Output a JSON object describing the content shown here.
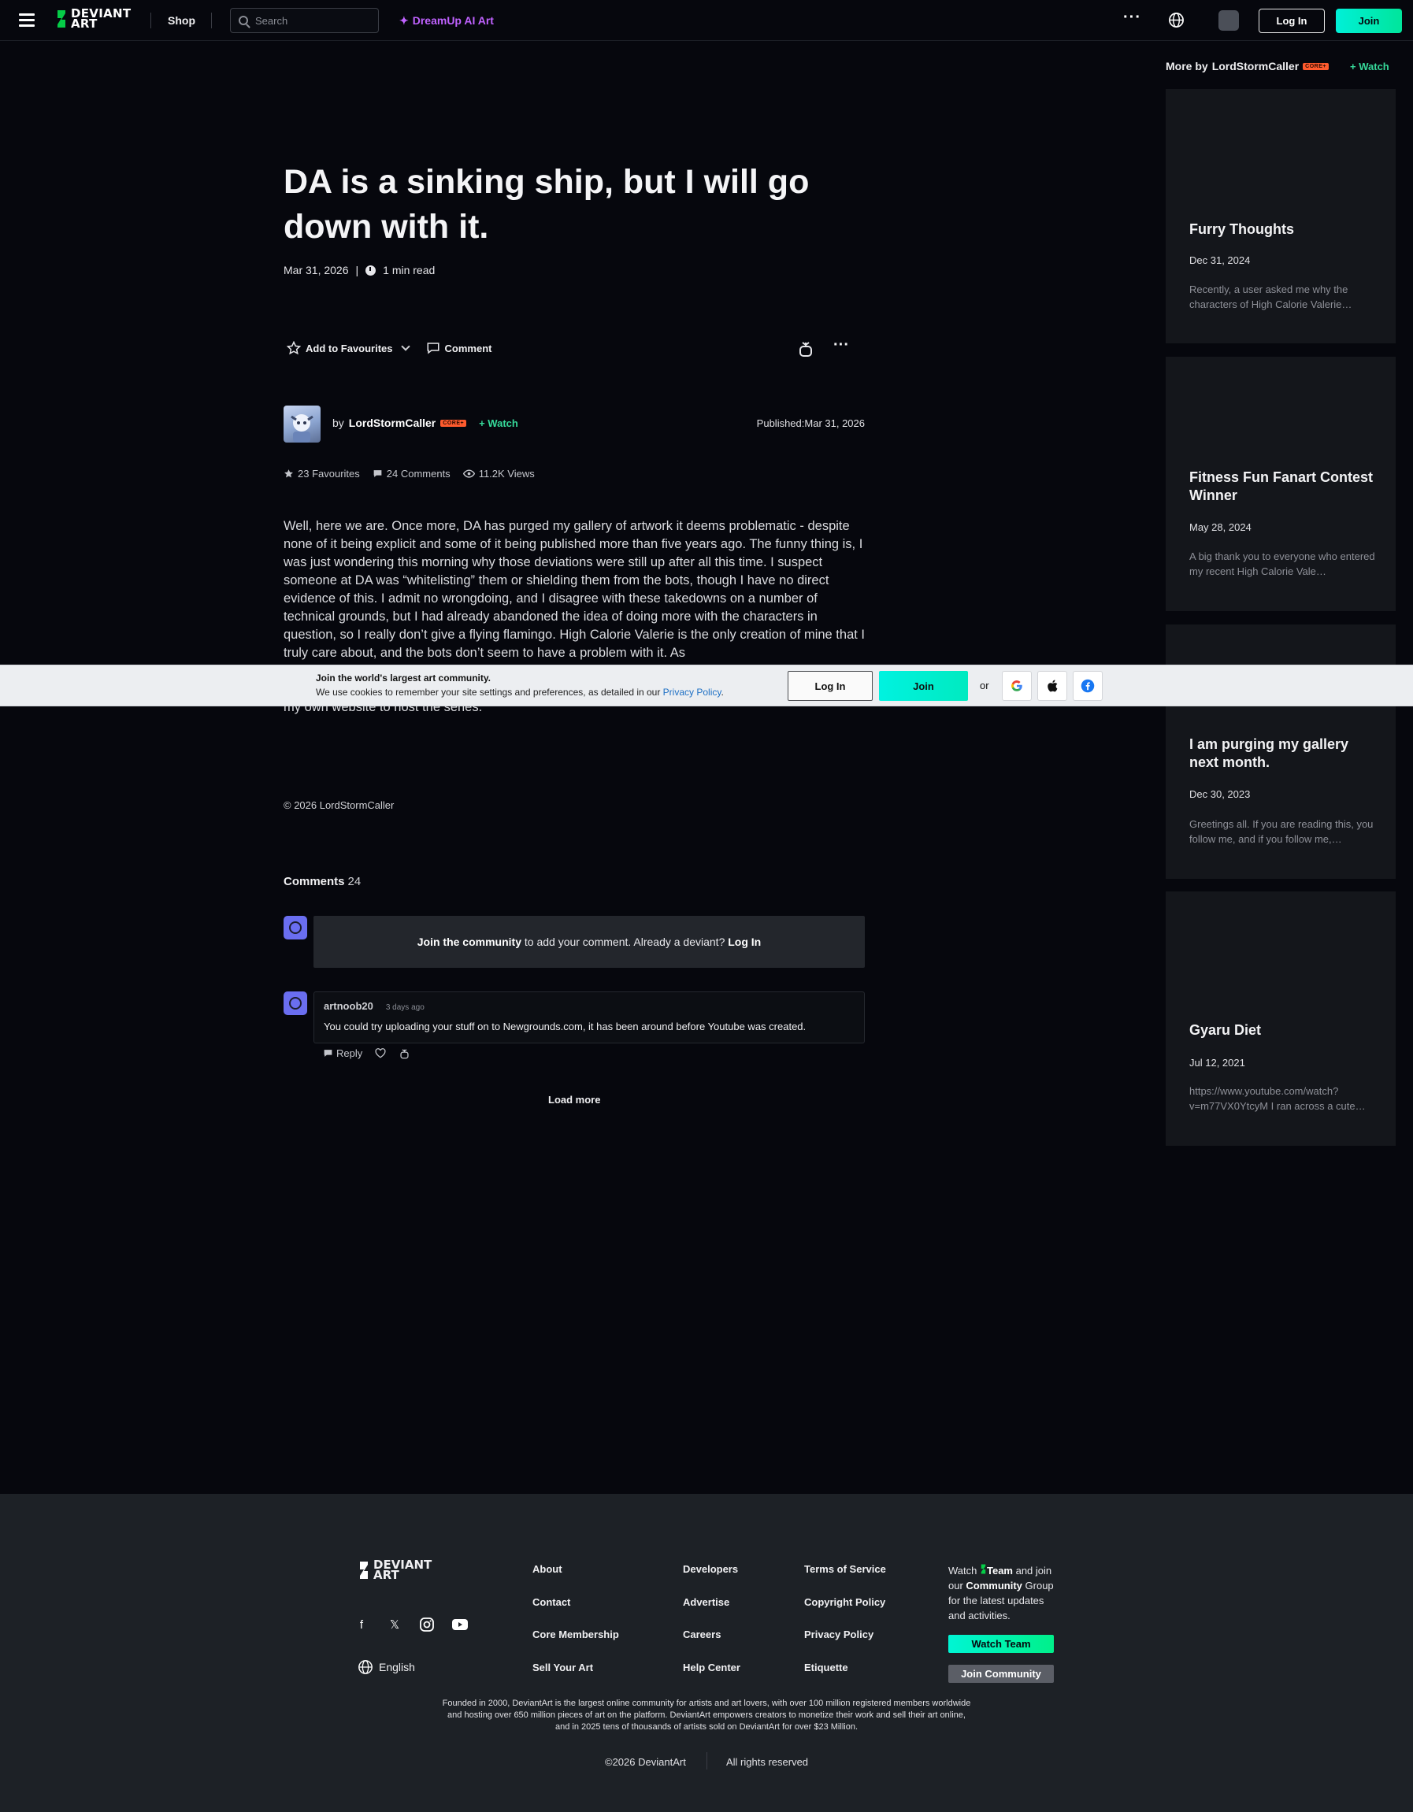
{
  "nav": {
    "logo_text": "DEVIANT ART",
    "shop": "Shop",
    "search_placeholder": "Search",
    "dreamup": "DreamUp AI Art",
    "login": "Log In",
    "join": "Join"
  },
  "article": {
    "title": "DA is a sinking ship, but I will go down with it.",
    "date": "Mar 31, 2026",
    "read_time": "1 min read",
    "add_to_favourites": "Add to Favourites",
    "comment": "Comment",
    "author_by": "by",
    "author_name": "LordStormCaller",
    "core_badge": "CORE+",
    "watch": "Watch",
    "published_label": "Published:",
    "published_date": "Mar 31, 2026",
    "stats": {
      "favourites": "23 Favourites",
      "comments": "24 Comments",
      "views": "11.2K Views"
    },
    "body_visible": "Well, here we are. Once more, DA has purged my gallery of artwork it deems problematic - despite none of it being explicit and some of it being published more than five years ago. The funny thing is, I was just wondering this morning why those deviations were still up after all this time. I suspect someone at DA was “whitelisting” them or shielding them from the bots, though I have no direct evidence of this. I admit no wrongdoing, and I disagree with these takedowns on a number of technical grounds, but I had already abandoned the idea of doing more with the characters in question, so I really don’t give a flying flamingo. High Calorie Valerie is the only creation of mine that I truly care about, and the bots don’t seem to have a problem with it. As",
    "body_after": "Just for the record, though it’s unlikely, if any of my High Calorie Valerie comics get axed, I will create my own website to host the series.",
    "copyright": "© 2026 LordStormCaller"
  },
  "comments": {
    "heading": "Comments",
    "count": "24",
    "join_strong": "Join the community",
    "join_rest": " to add your comment. Already a deviant? ",
    "join_login": "Log In",
    "items": [
      {
        "user": "artnoob20",
        "time": "3 days ago",
        "text": "You could try uploading your stuff on to Newgrounds.com, it has been around before Youtube was created.",
        "reply": "Reply"
      }
    ],
    "load_more": "Load more"
  },
  "sidebar": {
    "heading_prefix": "More by",
    "author": "LordStormCaller",
    "core_badge": "CORE+",
    "watch": "Watch",
    "cards": [
      {
        "title": "Furry Thoughts",
        "date": "Dec 31, 2024",
        "excerpt": "Recently, a user asked me why the characters of High Calorie Valerie…"
      },
      {
        "title": "Fitness Fun Fanart Contest Winner",
        "date": "May 28, 2024",
        "excerpt": "A big thank you to everyone who entered my recent High Calorie Vale…"
      },
      {
        "title": "I am purging my gallery next month.",
        "date": "Dec 30, 2023",
        "excerpt": "Greetings all. If you are reading this, you follow me, and if you follow me,…"
      },
      {
        "title": "Gyaru Diet",
        "date": "Jul 12, 2021",
        "excerpt": "https://www.youtube.com/watch?v=m77VX0YtcyM I ran across a cute…"
      }
    ]
  },
  "cookie": {
    "title": "Join the world's largest art community.",
    "text": "We use cookies to remember your site settings and preferences, as detailed in our ",
    "link": "Privacy Policy",
    "period": ".",
    "login": "Log In",
    "join": "Join",
    "or": "or"
  },
  "footer": {
    "logo_text": "DEVIANT ART",
    "language": "English",
    "col1": [
      "About",
      "Contact",
      "Core Membership",
      "Sell Your Art"
    ],
    "col2": [
      "Developers",
      "Advertise",
      "Careers",
      "Help Center"
    ],
    "col3": [
      "Terms of Service",
      "Copyright Policy",
      "Privacy Policy",
      "Etiquette"
    ],
    "watch_prefix": "Watch ",
    "watch_team": "Team",
    "watch_mid": " and join our ",
    "watch_community": "Community",
    "watch_suffix": " Group for the latest updates and activities.",
    "watch_team_btn": "Watch Team",
    "join_community_btn": "Join Community",
    "about_text": "Founded in 2000, DeviantArt is the largest online community for artists and art lovers, with over 100 million registered members worldwide and hosting over 650 million pieces of art on the platform. DeviantArt empowers creators to monetize their work and sell their art online, and in 2025 tens of thousands of artists sold on DeviantArt for over $23 Million.",
    "copyright": "©2026 DeviantArt",
    "rights": "All rights reserved"
  },
  "colors": {
    "accent": "#00e59b",
    "watch_green": "#36d99a",
    "dreamup": "#c062ff",
    "core_badge": "#ff5b2e"
  }
}
